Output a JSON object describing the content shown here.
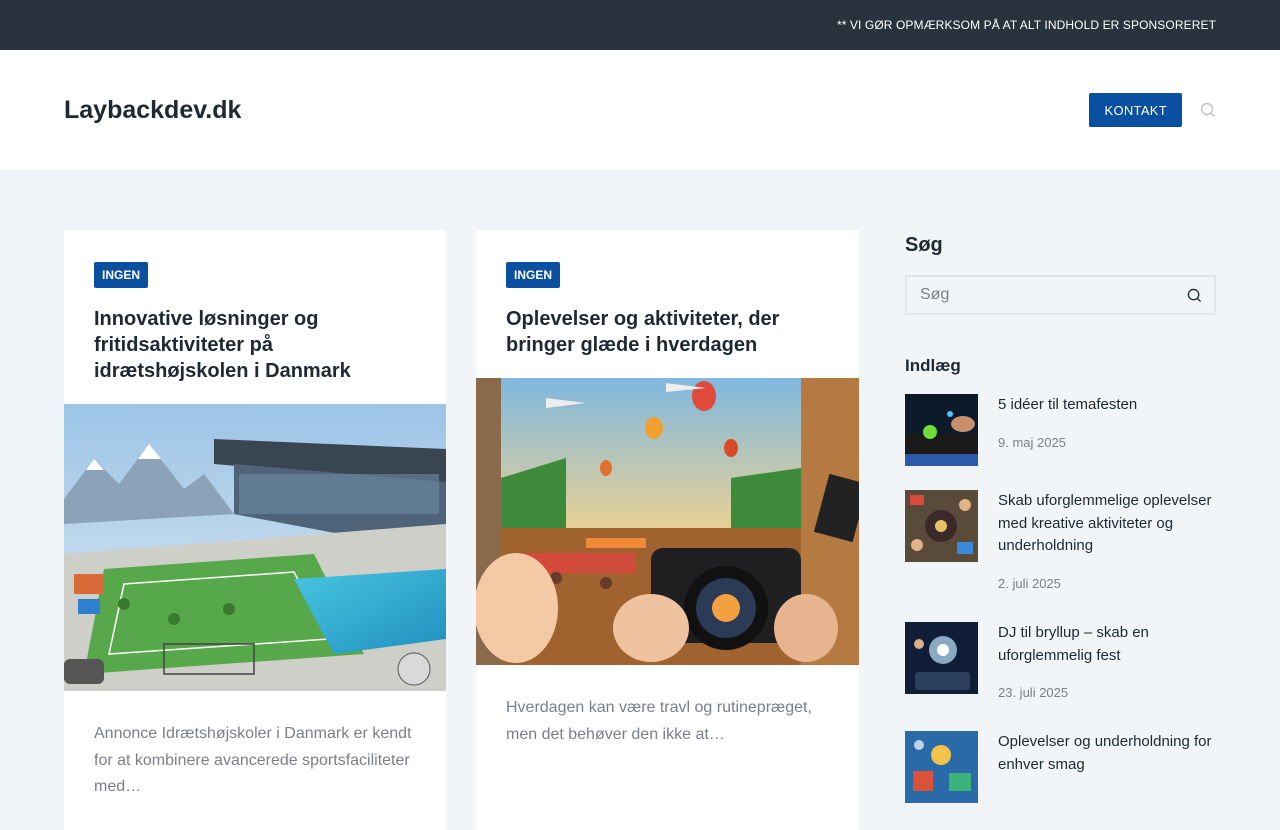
{
  "topbar": {
    "notice": "** VI GØR OPMÆRKSOM PÅ AT ALT INDHOLD ER SPONSORERET"
  },
  "header": {
    "site_title": "Laybackdev.dk",
    "contact_label": "KONTAKT",
    "search_icon": "search-icon"
  },
  "posts": [
    {
      "category": "INGEN",
      "title": "Innovative løsninger og fritidsaktiviteter på idrætshøjskolen i Danmark",
      "excerpt": "Annonce Idrætshøjskoler i Danmark er kendt for at kombinere avancerede sportsfaciliteter med…"
    },
    {
      "category": "INGEN",
      "title": "Oplevelser og aktiviteter, der bringer glæde i hverdagen",
      "excerpt": "Hverdagen kan være travl og rutinepræget, men det behøver den ikke at…"
    }
  ],
  "sidebar": {
    "search_title": "Søg",
    "search_placeholder": "Søg",
    "recent_title": "Indlæg",
    "recent": [
      {
        "title": "5 idéer til temafesten",
        "date": "9. maj 2025"
      },
      {
        "title": "Skab uforglemmelige oplevelser med kreative aktiviteter og underholdning",
        "date": "2. juli 2025"
      },
      {
        "title": "DJ til bryllup – skab en uforglemmelig fest",
        "date": "23. juli 2025"
      },
      {
        "title": "Oplevelser og underholdning for enhver smag",
        "date": ""
      }
    ]
  },
  "colors": {
    "accent": "#0a4fa0",
    "topbar": "#29333e",
    "background": "#f2f5f7"
  }
}
